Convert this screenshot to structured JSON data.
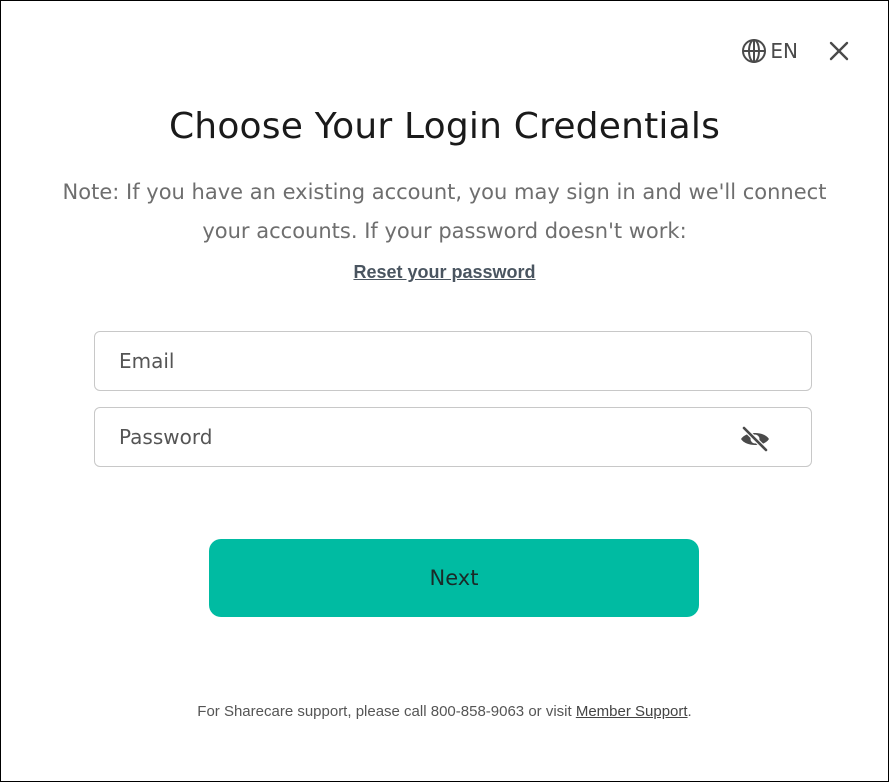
{
  "header": {
    "language_label": "EN",
    "language_icon": "globe-icon",
    "close_icon": "close-icon"
  },
  "title": "Choose Your Login Credentials",
  "note": "Note: If you have an existing account, you may sign in and we'll connect your accounts. If your password doesn't work:",
  "reset_link": "Reset your password",
  "form": {
    "email_placeholder": "Email",
    "email_value": "",
    "password_placeholder": "Password",
    "password_value": "",
    "password_visibility_icon": "eye-slash-icon"
  },
  "next_button": "Next",
  "footer": {
    "text": "For Sharecare support, please call 800-858-9063 or visit ",
    "link": "Member Support",
    "end": "."
  },
  "colors": {
    "accent": "#00bba2",
    "title": "#1a1a1a",
    "note": "#6e6e6e",
    "link": "#4a5560",
    "field_border": "#c8c8c8"
  }
}
